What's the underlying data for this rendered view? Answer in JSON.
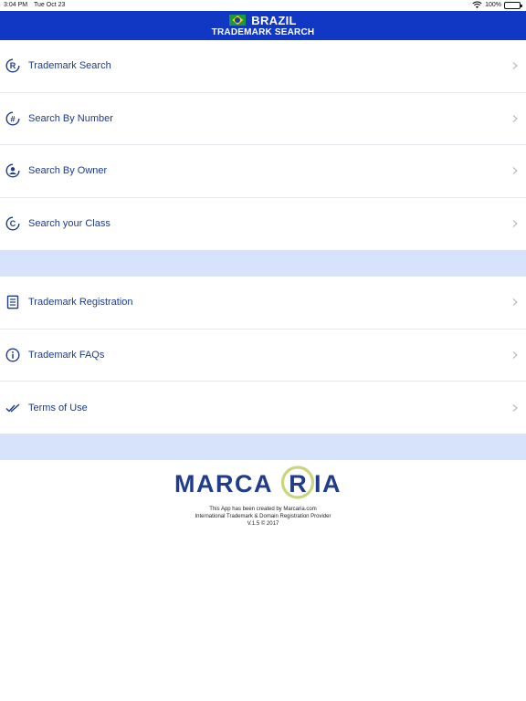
{
  "status_bar": {
    "time": "3:04 PM",
    "date": "Tue Oct 23",
    "battery": "100%"
  },
  "header": {
    "country": "BRAZIL",
    "subtitle": "TRADEMARK SEARCH"
  },
  "menu_primary": [
    {
      "label": "Trademark Search",
      "icon": "registered-icon"
    },
    {
      "label": "Search By Number",
      "icon": "hash-icon"
    },
    {
      "label": "Search By Owner",
      "icon": "owner-icon"
    },
    {
      "label": "Search your Class",
      "icon": "copyright-icon"
    }
  ],
  "menu_secondary": [
    {
      "label": "Trademark Registration",
      "icon": "document-icon"
    },
    {
      "label": "Trademark FAQs",
      "icon": "info-icon"
    },
    {
      "label": "Terms of Use",
      "icon": "double-check-icon"
    }
  ],
  "logo": {
    "text_left": "MARCA",
    "text_mid": "R",
    "text_right": "IA"
  },
  "footer": {
    "line1": "This App has been created by Marcaria.com",
    "line2": "International Trademark & Domain Registration Provider",
    "line3": "V.1.5 © 2017"
  },
  "colors": {
    "header": "#1038c4",
    "text": "#1e3a8a",
    "band": "#d6e3fb",
    "logo_blue": "#1f3d8c",
    "logo_green": "#c9d67a"
  }
}
